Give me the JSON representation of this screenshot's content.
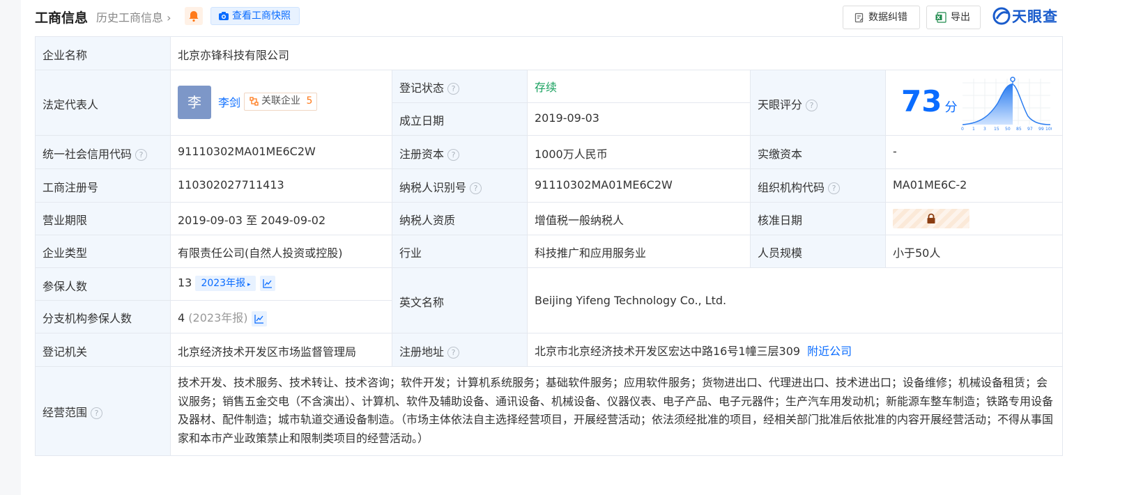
{
  "header": {
    "title": "工商信息",
    "history_link": "历史工商信息",
    "snapshot_button": "查看工商快照",
    "correct_button": "数据纠错",
    "export_button": "导出",
    "logo_text": "天眼查"
  },
  "rows": {
    "company_name": {
      "label": "企业名称",
      "value": "北京亦锋科技有限公司"
    },
    "legal_rep": {
      "label": "法定代表人",
      "avatar_char": "李",
      "name": "李剑",
      "related_label": "关联企业",
      "related_count": "5"
    },
    "reg_status": {
      "label": "登记状态",
      "value": "存续"
    },
    "founded": {
      "label": "成立日期",
      "value": "2019-09-03"
    },
    "tianyan_score": {
      "label": "天眼评分",
      "score": "73",
      "unit": "分",
      "axis_ticks": [
        "0",
        "1",
        "3",
        "15",
        "50",
        "85",
        "97",
        "99",
        "100"
      ]
    },
    "credit_code": {
      "label": "统一社会信用代码",
      "value": "91110302MA01ME6C2W"
    },
    "reg_capital": {
      "label": "注册资本",
      "value": "1000万人民币"
    },
    "paid_capital": {
      "label": "实缴资本",
      "value": "-"
    },
    "biz_reg_no": {
      "label": "工商注册号",
      "value": "110302027711413"
    },
    "taxpayer_id": {
      "label": "纳税人识别号",
      "value": "91110302MA01ME6C2W"
    },
    "org_code": {
      "label": "组织机构代码",
      "value": "MA01ME6C-2"
    },
    "biz_term": {
      "label": "营业期限",
      "value": "2019-09-03 至 2049-09-02"
    },
    "taxpayer_qual": {
      "label": "纳税人资质",
      "value": "增值税一般纳税人"
    },
    "approve_date": {
      "label": "核准日期"
    },
    "company_type": {
      "label": "企业类型",
      "value": "有限责任公司(自然人投资或控股)"
    },
    "industry": {
      "label": "行业",
      "value": "科技推广和应用服务业"
    },
    "staff_size": {
      "label": "人员规模",
      "value": "小于50人"
    },
    "insured": {
      "label": "参保人数",
      "value": "13",
      "year_tag": "2023年报"
    },
    "branch_insured": {
      "label": "分支机构参保人数",
      "value": "4",
      "year_note": "(2023年报)"
    },
    "english_name": {
      "label": "英文名称",
      "value": "Beijing Yifeng Technology Co., Ltd."
    },
    "reg_authority": {
      "label": "登记机关",
      "value": "北京经济技术开发区市场监督管理局"
    },
    "reg_address": {
      "label": "注册地址",
      "value": "北京市北京经济技术开发区宏达中路16号1幢三层309",
      "nearby_link": "附近公司"
    },
    "biz_scope": {
      "label": "经营范围",
      "value": "技术开发、技术服务、技术转让、技术咨询；软件开发；计算机系统服务；基础软件服务；应用软件服务；货物进出口、代理进出口、技术进出口；设备维修；机械设备租赁；会议服务；销售五金交电（不含演出）、计算机、软件及辅助设备、通讯设备、机械设备、仪器仪表、电子产品、电子元器件；生产汽车用发动机；新能源车整车制造；铁路专用设备及器材、配件制造；城市轨道交通设备制造。（市场主体依法自主选择经营项目，开展经营活动；依法须经批准的项目，经相关部门批准后依批准的内容开展经营活动；不得从事国家和本市产业政策禁止和限制类项目的经营活动。）"
    }
  },
  "colors": {
    "accent": "#0a6cff",
    "status_green": "#19a15f",
    "label_bg": "#f2f7fd",
    "border": "#e4e8ef"
  }
}
